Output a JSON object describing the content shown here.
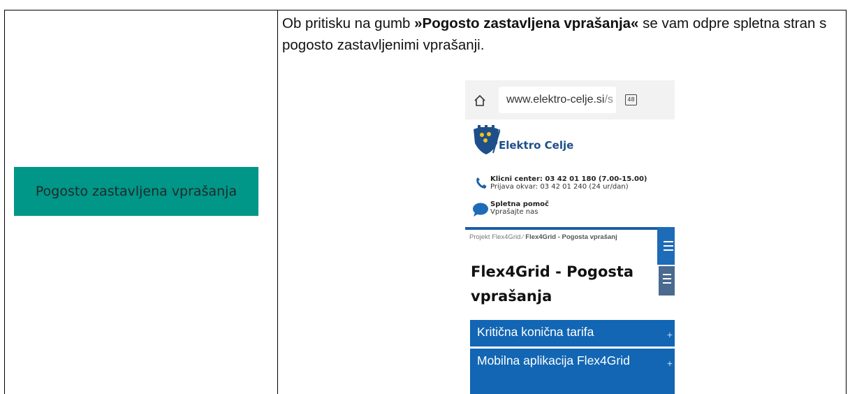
{
  "faq_button": {
    "label": "Pogosto zastavljena vprašanja",
    "color": "#009688"
  },
  "description": {
    "prefix": "Ob pritisku na gumb ",
    "bold": "»Pogosto zastavljena vprašanja«",
    "suffix": " se vam odpre spletna stran s pogosto zastavljenimi vprašanji."
  },
  "phone": {
    "url_main": "www.elektro-celje.si",
    "url_dim": "/s",
    "tab_count": "48",
    "brand": "Elektro Celje",
    "call_center": "Klicni center: 03 42 01 180 (7.00-15.00)",
    "fault_report": "Prijava okvar: 03 42 01 240 (24 ur/dan)",
    "help_title": "Spletna pomoč",
    "help_sub": "Vprašajte nas",
    "breadcrumb_parent": "Projekt Flex4Grid",
    "breadcrumb_sep": " ⁄ ",
    "breadcrumb_current": "Flex4Grid - Pogosta vprašanj",
    "page_title": "Flex4Grid - Pogosta vprašanja",
    "accordion": [
      {
        "label": "Kritična konična tarifa",
        "toggle": "+"
      },
      {
        "label": "Mobilna aplikacija Flex4Grid",
        "toggle": "+"
      }
    ],
    "accent_color": "#1266b4"
  }
}
